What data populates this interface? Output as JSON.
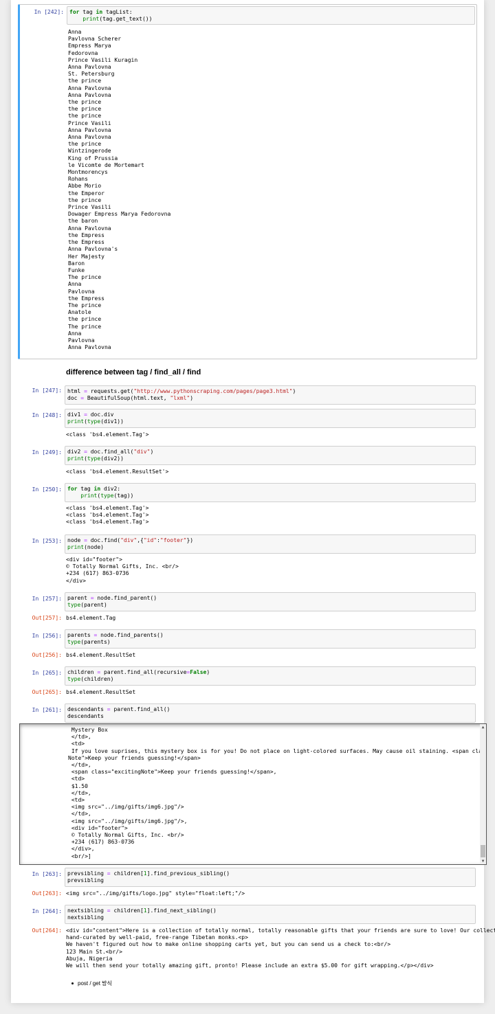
{
  "cells": [
    {
      "id": "c242",
      "prompt": "In [242]:",
      "code_lines": [
        "for tag in tagList:",
        "    print(tag.get_text())"
      ],
      "output": "Anna\nPavlovna Scherer\nEmpress Marya\nFedorovna\nPrince Vasili Kuragin\nAnna Pavlovna\nSt. Petersburg\nthe prince\nAnna Pavlovna\nAnna Pavlovna\nthe prince\nthe prince\nthe prince\nPrince Vasili\nAnna Pavlovna\nAnna Pavlovna\nthe prince\nWintzingerode\nKing of Prussia\nle Vicomte de Mortemart\nMontmorencys\nRohans\nAbbe Morio\nthe Emperor\nthe prince\nPrince Vasili\nDowager Empress Marya Fedorovna\nthe baron\nAnna Pavlovna\nthe Empress\nthe Empress\nAnna Pavlovna's\nHer Majesty\nBaron\nFunke\nThe prince\nAnna\nPavlovna\nthe Empress\nThe prince\nAnatole\nthe prince\nThe prince\nAnna\nPavlovna\nAnna Pavlovna"
    },
    {
      "id": "c247",
      "prompt": "In [247]:",
      "code_lines": [
        "html = requests.get(\"http://www.pythonscraping.com/pages/page3.html\")",
        "doc = BeautifulSoup(html.text, \"lxml\")"
      ]
    },
    {
      "id": "c248",
      "prompt": "In [248]:",
      "code_lines": [
        "div1 = doc.div",
        "print(type(div1))"
      ],
      "output": "<class 'bs4.element.Tag'>"
    },
    {
      "id": "c249",
      "prompt": "In [249]:",
      "code_lines": [
        "div2 = doc.find_all(\"div\")",
        "print(type(div2))"
      ],
      "output": "<class 'bs4.element.ResultSet'>"
    },
    {
      "id": "c250",
      "prompt": "In [250]:",
      "code_lines": [
        "for tag in div2:",
        "    print(type(tag))"
      ],
      "output": "<class 'bs4.element.Tag'>\n<class 'bs4.element.Tag'>\n<class 'bs4.element.Tag'>"
    },
    {
      "id": "c253",
      "prompt": "In [253]:",
      "code_lines": [
        "node = doc.find(\"div\",{\"id\":\"footer\"})",
        "print(node)"
      ],
      "output": "<div id=\"footer\">\n© Totally Normal Gifts, Inc. <br/>\n+234 (617) 863-0736\n</div>"
    },
    {
      "id": "c257",
      "prompt": "In [257]:",
      "code_lines": [
        "parent = node.find_parent()",
        "type(parent)"
      ],
      "out_prompt": "Out[257]:",
      "output": "bs4.element.Tag"
    },
    {
      "id": "c256",
      "prompt": "In [256]:",
      "code_lines": [
        "parents = node.find_parents()",
        "type(parents)"
      ],
      "out_prompt": "Out[256]:",
      "output": "bs4.element.ResultSet"
    },
    {
      "id": "c265",
      "prompt": "In [265]:",
      "code_lines": [
        "children = parent.find_all(recursive=False)",
        "type(children)"
      ],
      "out_prompt": "Out[265]:",
      "output": "bs4.element.ResultSet"
    },
    {
      "id": "c261",
      "prompt": "In [261]:",
      "code_lines": [
        "descendants = parent.find_all()",
        "descendants"
      ],
      "scroll_output": " Mystery Box\n </td>,\n <td>\n If you love suprises, this mystery box is for you! Do not place on light-colored surfaces. May cause oil staining. <span class=\"exciting\nNote\">Keep your friends guessing!</span>\n </td>,\n <span class=\"excitingNote\">Keep your friends guessing!</span>,\n <td>\n $1.50\n </td>,\n <td>\n <img src=\"../img/gifts/img6.jpg\"/>\n </td>,\n <img src=\"../img/gifts/img6.jpg\"/>,\n <div id=\"footer\">\n © Totally Normal Gifts, Inc. <br/>\n +234 (617) 863-0736\n </div>,\n <br/>]"
    },
    {
      "id": "c263",
      "prompt": "In [263]:",
      "code_lines": [
        "prevsibling = children[1].find_previous_sibling()",
        "prevsibling"
      ],
      "out_prompt": "Out[263]:",
      "output": "<img src=\"../img/gifts/logo.jpg\" style=\"float:left;\"/>"
    },
    {
      "id": "c264",
      "prompt": "In [264]:",
      "code_lines": [
        "nextsibling = children[1].find_next_sibling()",
        "nextsibling"
      ],
      "out_prompt": "Out[264]:",
      "output": "<div id=\"content\">Here is a collection of totally normal, totally reasonable gifts that your friends are sure to love! Our collection is\nhand-curated by well-paid, free-range Tibetan monks.<p>\nWe haven't figured out how to make online shopping carts yet, but you can send us a check to:<br/>\n123 Main St.<br/>\nAbuja, Nigeria\nWe will then send your totally amazing gift, pronto! Please include an extra $5.00 for gift wrapping.</p></div>"
    }
  ],
  "heading": "difference between tag / find_all / find",
  "bullet": "post / get 방식"
}
